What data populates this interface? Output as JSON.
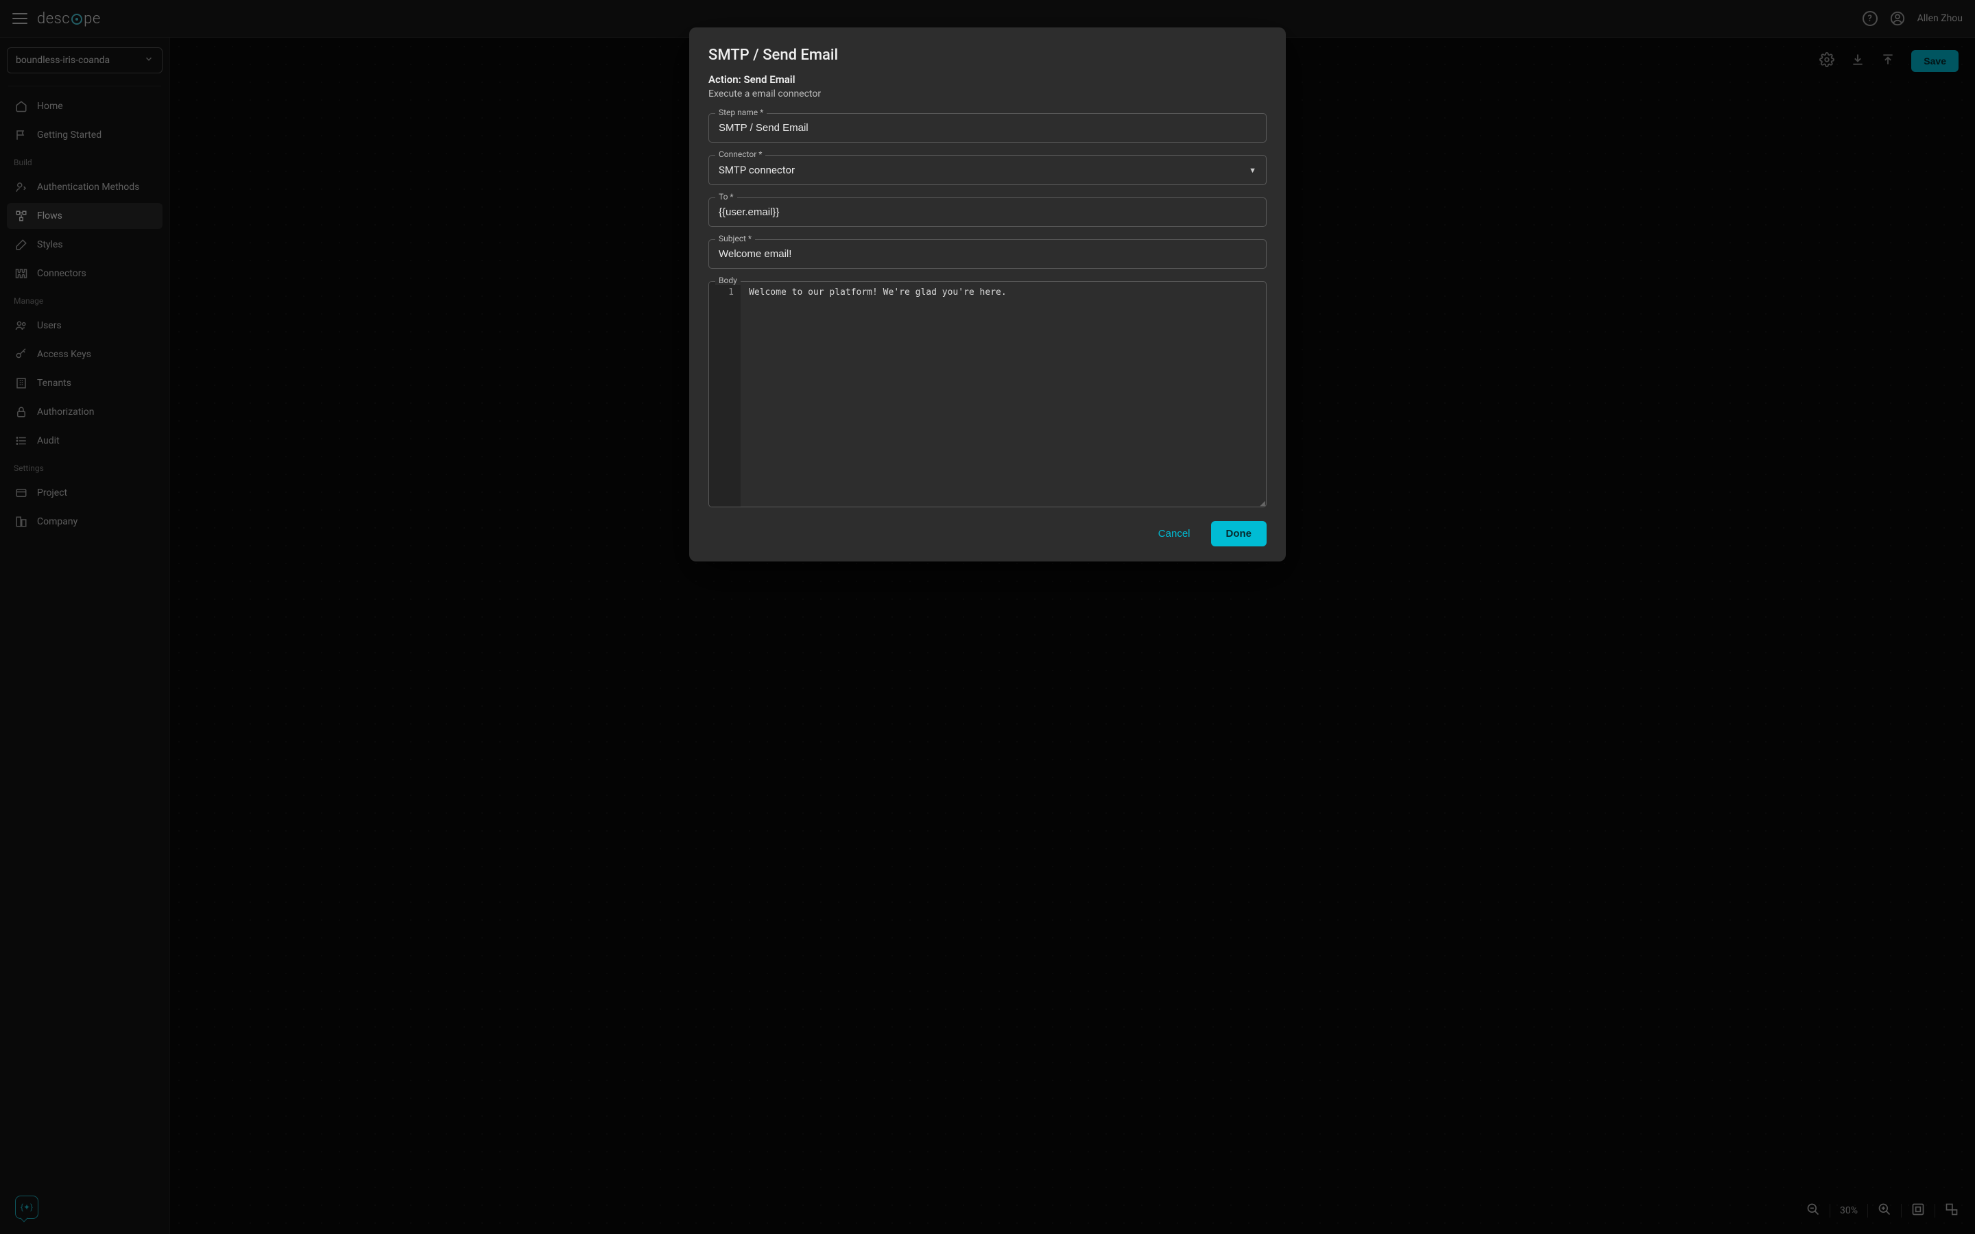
{
  "header": {
    "user_name": "Allen Zhou"
  },
  "sidebar": {
    "project": "boundless-iris-coanda",
    "items_top": [
      {
        "label": "Home"
      },
      {
        "label": "Getting Started"
      }
    ],
    "sections": {
      "build": "Build",
      "manage": "Manage",
      "settings": "Settings"
    },
    "build_items": [
      {
        "label": "Authentication Methods"
      },
      {
        "label": "Flows"
      },
      {
        "label": "Styles"
      },
      {
        "label": "Connectors"
      }
    ],
    "manage_items": [
      {
        "label": "Users"
      },
      {
        "label": "Access Keys"
      },
      {
        "label": "Tenants"
      },
      {
        "label": "Authorization"
      },
      {
        "label": "Audit"
      }
    ],
    "settings_items": [
      {
        "label": "Project"
      },
      {
        "label": "Company"
      }
    ]
  },
  "toolbar": {
    "save_label": "Save"
  },
  "zoom": {
    "percent": "30%"
  },
  "modal": {
    "title": "SMTP / Send Email",
    "action_label": "Action: Send Email",
    "description": "Execute a email connector",
    "fields": {
      "step_name_label": "Step name *",
      "step_name_value": "SMTP / Send Email",
      "connector_label": "Connector *",
      "connector_value": "SMTP connector",
      "to_label": "To *",
      "to_value": "{{user.email}}",
      "subject_label": "Subject *",
      "subject_value": "Welcome email!",
      "body_label": "Body",
      "body_line_number": "1",
      "body_value": "Welcome to our platform! We're glad you're here."
    },
    "buttons": {
      "cancel": "Cancel",
      "done": "Done"
    }
  }
}
